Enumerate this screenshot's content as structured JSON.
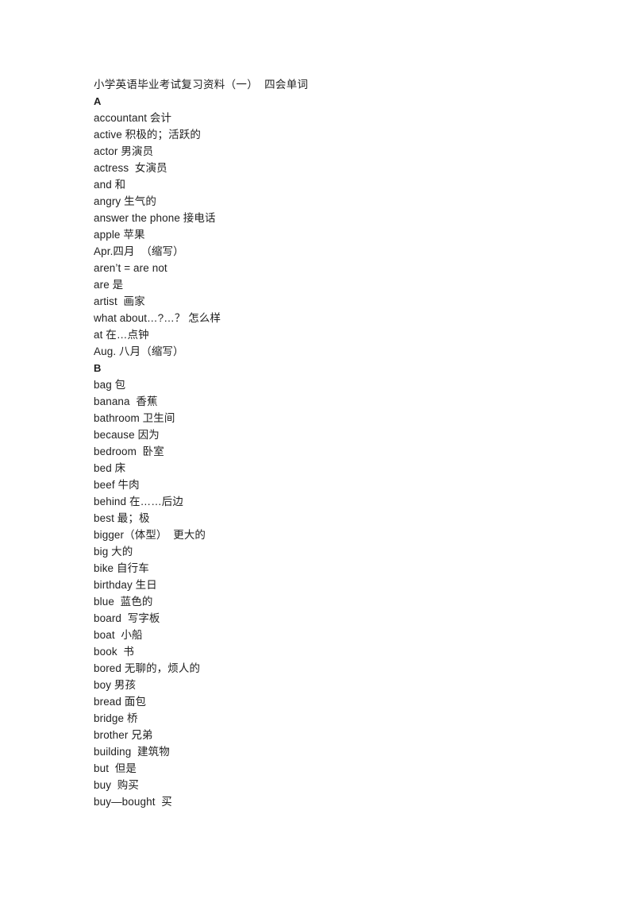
{
  "document": {
    "title": "小学英语毕业考试复习资料（一）  四会单词",
    "lines": [
      {
        "id": "title",
        "kind": "title",
        "text": "小学英语毕业考试复习资料（一）  四会单词"
      },
      {
        "id": "section-a",
        "kind": "section-letter",
        "text": "A"
      },
      {
        "id": "entry-accountant",
        "kind": "entry",
        "text": "accountant 会计"
      },
      {
        "id": "entry-active",
        "kind": "entry",
        "text": "active 积极的；活跃的"
      },
      {
        "id": "entry-actor",
        "kind": "entry",
        "text": "actor 男演员"
      },
      {
        "id": "entry-actress",
        "kind": "entry",
        "text": "actress  女演员"
      },
      {
        "id": "entry-and",
        "kind": "entry",
        "text": "and 和"
      },
      {
        "id": "entry-angry",
        "kind": "entry",
        "text": "angry 生气的"
      },
      {
        "id": "entry-answer-the-phone",
        "kind": "entry",
        "text": "answer the phone 接电话"
      },
      {
        "id": "entry-apple",
        "kind": "entry",
        "text": "apple 苹果"
      },
      {
        "id": "entry-apr",
        "kind": "entry",
        "text": "Apr.四月  （缩写）"
      },
      {
        "id": "entry-arent",
        "kind": "entry",
        "text": "aren’t = are not"
      },
      {
        "id": "entry-are",
        "kind": "entry",
        "text": "are 是"
      },
      {
        "id": "entry-artist",
        "kind": "entry",
        "text": "artist  画家"
      },
      {
        "id": "entry-what-about",
        "kind": "entry",
        "text": "what about…?…？ 怎么样"
      },
      {
        "id": "entry-at",
        "kind": "entry",
        "text": "at 在…点钟"
      },
      {
        "id": "entry-aug",
        "kind": "entry",
        "text": "Aug. 八月（缩写）"
      },
      {
        "id": "section-b",
        "kind": "section-letter",
        "text": "B"
      },
      {
        "id": "entry-bag",
        "kind": "entry",
        "text": "bag 包"
      },
      {
        "id": "entry-banana",
        "kind": "entry",
        "text": "banana  香蕉"
      },
      {
        "id": "entry-bathroom",
        "kind": "entry",
        "text": "bathroom 卫生间"
      },
      {
        "id": "entry-because",
        "kind": "entry",
        "text": "because 因为"
      },
      {
        "id": "entry-bedroom",
        "kind": "entry",
        "text": "bedroom  卧室"
      },
      {
        "id": "entry-bed",
        "kind": "entry",
        "text": "bed 床"
      },
      {
        "id": "entry-beef",
        "kind": "entry",
        "text": "beef 牛肉"
      },
      {
        "id": "entry-behind",
        "kind": "entry",
        "text": "behind 在……后边"
      },
      {
        "id": "entry-best",
        "kind": "entry",
        "text": "best 最；极"
      },
      {
        "id": "entry-bigger",
        "kind": "entry",
        "text": "bigger（体型）  更大的"
      },
      {
        "id": "entry-big",
        "kind": "entry",
        "text": "big 大的"
      },
      {
        "id": "entry-bike",
        "kind": "entry",
        "text": "bike 自行车"
      },
      {
        "id": "entry-birthday",
        "kind": "entry",
        "text": "birthday 生日"
      },
      {
        "id": "entry-blue",
        "kind": "entry",
        "text": "blue  蓝色的"
      },
      {
        "id": "entry-board",
        "kind": "entry",
        "text": "board  写字板"
      },
      {
        "id": "entry-boat",
        "kind": "entry",
        "text": "boat  小船"
      },
      {
        "id": "entry-book",
        "kind": "entry",
        "text": "book  书"
      },
      {
        "id": "entry-bored",
        "kind": "entry",
        "text": "bored 无聊的，烦人的"
      },
      {
        "id": "entry-boy",
        "kind": "entry",
        "text": "boy 男孩"
      },
      {
        "id": "entry-bread",
        "kind": "entry",
        "text": "bread 面包"
      },
      {
        "id": "entry-bridge",
        "kind": "entry",
        "text": "bridge 桥"
      },
      {
        "id": "entry-brother",
        "kind": "entry",
        "text": "brother 兄弟"
      },
      {
        "id": "entry-building",
        "kind": "entry",
        "text": "building  建筑物"
      },
      {
        "id": "entry-but",
        "kind": "entry",
        "text": "but  但是"
      },
      {
        "id": "entry-buy",
        "kind": "entry",
        "text": "buy  购买"
      },
      {
        "id": "entry-buy-bought",
        "kind": "entry",
        "text": "buy—bought  买"
      }
    ]
  }
}
